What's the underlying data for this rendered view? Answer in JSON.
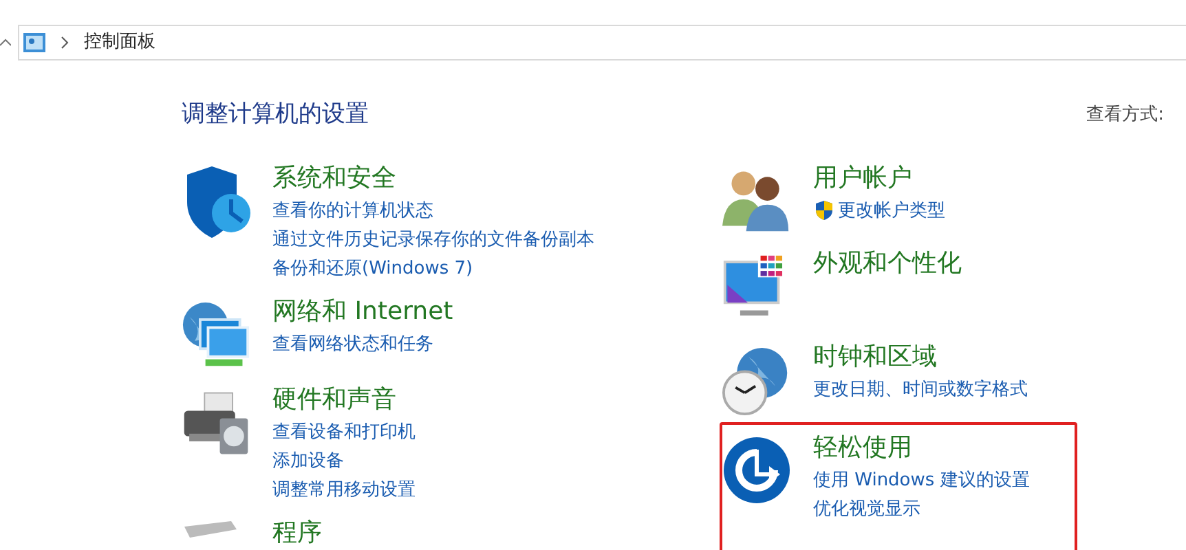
{
  "address_bar": {
    "path": "控制面板"
  },
  "heading": "调整计算机的设置",
  "view_by": {
    "label": "查看方式:"
  },
  "columns": [
    {
      "categories": [
        {
          "title": "系统和安全",
          "highlighted": false,
          "links": [
            {
              "text": "查看你的计算机状态",
              "shield": false
            },
            {
              "text": "通过文件历史记录保存你的文件备份副本",
              "shield": false
            },
            {
              "text": "备份和还原(Windows 7)",
              "shield": false
            }
          ]
        },
        {
          "title": "网络和 Internet",
          "highlighted": false,
          "links": [
            {
              "text": "查看网络状态和任务",
              "shield": false
            }
          ]
        },
        {
          "title": "硬件和声音",
          "highlighted": false,
          "links": [
            {
              "text": "查看设备和打印机",
              "shield": false
            },
            {
              "text": "添加设备",
              "shield": false
            },
            {
              "text": "调整常用移动设置",
              "shield": false
            }
          ]
        },
        {
          "title": "程序",
          "highlighted": false
        }
      ]
    },
    {
      "categories": [
        {
          "title": "用户帐户",
          "highlighted": false,
          "links": [
            {
              "text": "更改帐户类型",
              "shield": true
            }
          ]
        },
        {
          "title": "外观和个性化",
          "highlighted": false
        },
        {
          "title": "时钟和区域",
          "highlighted": false,
          "links": [
            {
              "text": "更改日期、时间或数字格式",
              "shield": false
            }
          ]
        },
        {
          "title": "轻松使用",
          "highlighted": true,
          "links": [
            {
              "text": "使用 Windows 建议的设置",
              "shield": false
            },
            {
              "text": "优化视觉显示",
              "shield": false
            }
          ]
        }
      ]
    }
  ]
}
